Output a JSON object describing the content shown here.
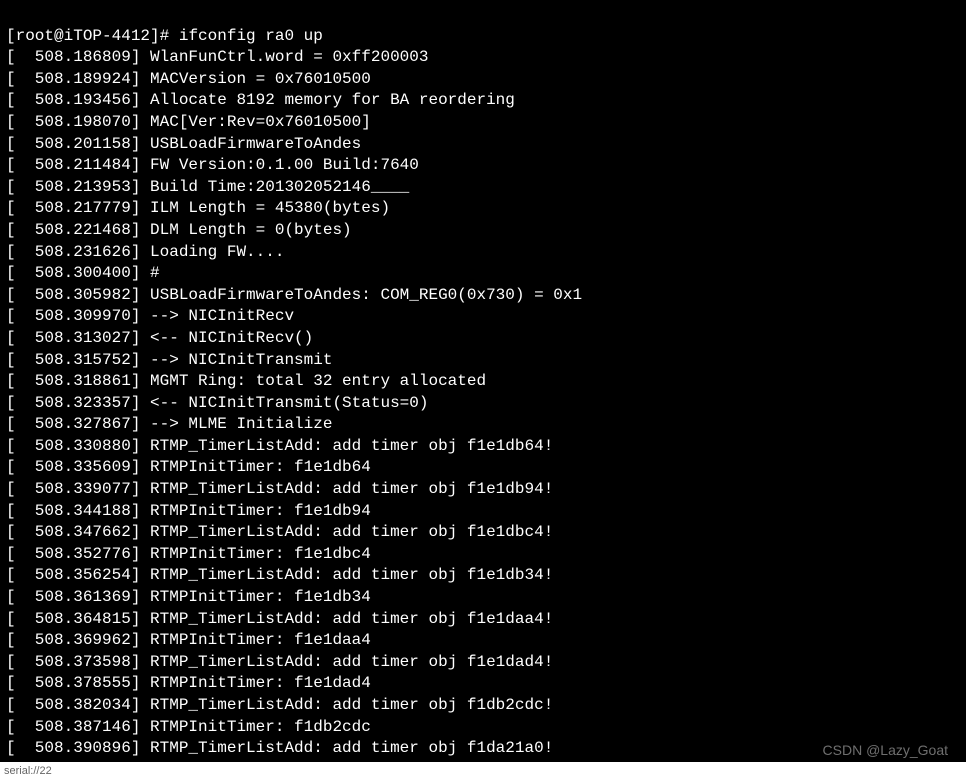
{
  "prompt": {
    "user_host": "[root@iTOP-4412]#",
    "command": "ifconfig ra0 up"
  },
  "lines": [
    {
      "ts": "508.186809",
      "msg": "WlanFunCtrl.word = 0xff200003"
    },
    {
      "ts": "508.189924",
      "msg": "MACVersion = 0x76010500"
    },
    {
      "ts": "508.193456",
      "msg": "Allocate 8192 memory for BA reordering"
    },
    {
      "ts": "508.198070",
      "msg": "MAC[Ver:Rev=0x76010500]"
    },
    {
      "ts": "508.201158",
      "msg": "USBLoadFirmwareToAndes"
    },
    {
      "ts": "508.211484",
      "msg": "FW Version:0.1.00 Build:7640"
    },
    {
      "ts": "508.213953",
      "msg": "Build Time:201302052146____"
    },
    {
      "ts": "508.217779",
      "msg": "ILM Length = 45380(bytes)"
    },
    {
      "ts": "508.221468",
      "msg": "DLM Length = 0(bytes)"
    },
    {
      "ts": "508.231626",
      "msg": "Loading FW...."
    },
    {
      "ts": "508.300400",
      "msg": "#"
    },
    {
      "ts": "508.305982",
      "msg": "USBLoadFirmwareToAndes: COM_REG0(0x730) = 0x1"
    },
    {
      "ts": "508.309970",
      "msg": "--> NICInitRecv"
    },
    {
      "ts": "508.313027",
      "msg": "<-- NICInitRecv()"
    },
    {
      "ts": "508.315752",
      "msg": "--> NICInitTransmit"
    },
    {
      "ts": "508.318861",
      "msg": "MGMT Ring: total 32 entry allocated"
    },
    {
      "ts": "508.323357",
      "msg": "<-- NICInitTransmit(Status=0)"
    },
    {
      "ts": "508.327867",
      "msg": "--> MLME Initialize"
    },
    {
      "ts": "508.330880",
      "msg": "RTMP_TimerListAdd: add timer obj f1e1db64!"
    },
    {
      "ts": "508.335609",
      "msg": "RTMPInitTimer: f1e1db64"
    },
    {
      "ts": "508.339077",
      "msg": "RTMP_TimerListAdd: add timer obj f1e1db94!"
    },
    {
      "ts": "508.344188",
      "msg": "RTMPInitTimer: f1e1db94"
    },
    {
      "ts": "508.347662",
      "msg": "RTMP_TimerListAdd: add timer obj f1e1dbc4!"
    },
    {
      "ts": "508.352776",
      "msg": "RTMPInitTimer: f1e1dbc4"
    },
    {
      "ts": "508.356254",
      "msg": "RTMP_TimerListAdd: add timer obj f1e1db34!"
    },
    {
      "ts": "508.361369",
      "msg": "RTMPInitTimer: f1e1db34"
    },
    {
      "ts": "508.364815",
      "msg": "RTMP_TimerListAdd: add timer obj f1e1daa4!"
    },
    {
      "ts": "508.369962",
      "msg": "RTMPInitTimer: f1e1daa4"
    },
    {
      "ts": "508.373598",
      "msg": "RTMP_TimerListAdd: add timer obj f1e1dad4!"
    },
    {
      "ts": "508.378555",
      "msg": "RTMPInitTimer: f1e1dad4"
    },
    {
      "ts": "508.382034",
      "msg": "RTMP_TimerListAdd: add timer obj f1db2cdc!"
    },
    {
      "ts": "508.387146",
      "msg": "RTMPInitTimer: f1db2cdc"
    },
    {
      "ts": "508.390896",
      "msg": "RTMP_TimerListAdd: add timer obj f1da21a0!"
    }
  ],
  "watermark": "CSDN @Lazy_Goat",
  "footer_text": "serial://22"
}
